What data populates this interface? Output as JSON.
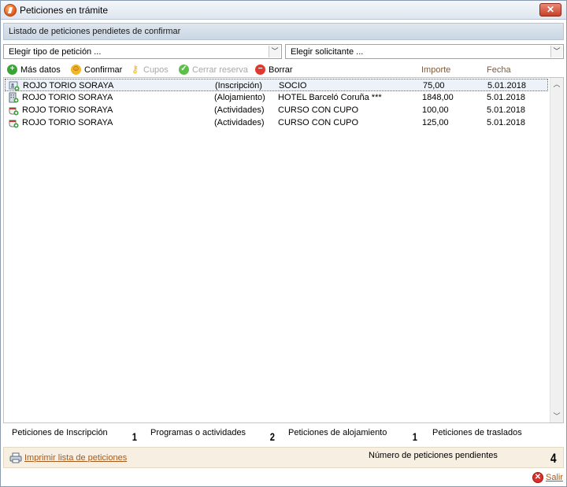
{
  "window": {
    "title": "Peticiones en trámite",
    "close_symbol": "✕"
  },
  "header": {
    "text": "Listado de peticiones pendietes de confirmar"
  },
  "filters": {
    "tipo": {
      "value": "Elegir tipo de petición ..."
    },
    "solicitante": {
      "value": "Elegir solicitante ..."
    }
  },
  "toolbar": {
    "mas_datos": {
      "label": "Más datos",
      "icon": "plus-circle-icon",
      "color": "#3aa537"
    },
    "confirmar": {
      "label": "Confirmar",
      "icon": "smiley-icon",
      "color": "#f3b52b"
    },
    "cupos": {
      "label": "Cupos",
      "icon": "key-icon",
      "color": "#f3c44d",
      "disabled": true
    },
    "cerrar_reserva": {
      "label": "Cerrar reserva",
      "icon": "check-circle-icon",
      "color": "#5cbf4a",
      "disabled": true
    },
    "borrar": {
      "label": "Borrar",
      "icon": "minus-circle-icon",
      "color": "#de3b30"
    }
  },
  "columns": {
    "importe": "Importe",
    "fecha": "Fecha"
  },
  "rows": [
    {
      "name": "ROJO TORIO SORAYA",
      "type": "(Inscripción)",
      "desc": "SOCIO",
      "importe": "75,00",
      "fecha": "5.01.2018",
      "icon": "person-card-icon"
    },
    {
      "name": "ROJO TORIO SORAYA",
      "type": "(Alojamiento)",
      "desc": "HOTEL Barceló Coruña ***",
      "importe": "1848,00",
      "fecha": "5.01.2018",
      "icon": "hotel-building-icon"
    },
    {
      "name": "ROJO TORIO SORAYA",
      "type": "(Actividades)",
      "desc": "CURSO CON CUPO",
      "importe": "100,00",
      "fecha": "5.01.2018",
      "icon": "coffee-cup-icon"
    },
    {
      "name": "ROJO TORIO SORAYA",
      "type": "(Actividades)",
      "desc": "CURSO CON CUPO",
      "importe": "125,00",
      "fecha": "5.01.2018",
      "icon": "coffee-cup-icon"
    }
  ],
  "stats": [
    {
      "label": "Peticiones de Inscripción",
      "value": "1"
    },
    {
      "label": "Programas o actividades",
      "value": "2"
    },
    {
      "label": "Peticiones de alojamiento",
      "value": "1"
    },
    {
      "label": "Peticiones de traslados",
      "value": ""
    }
  ],
  "footer": {
    "print_link": "Imprimir lista de peticiones",
    "pending_label": "Número de peticiones pendientes",
    "pending_value": "4",
    "salir": "Salir"
  }
}
